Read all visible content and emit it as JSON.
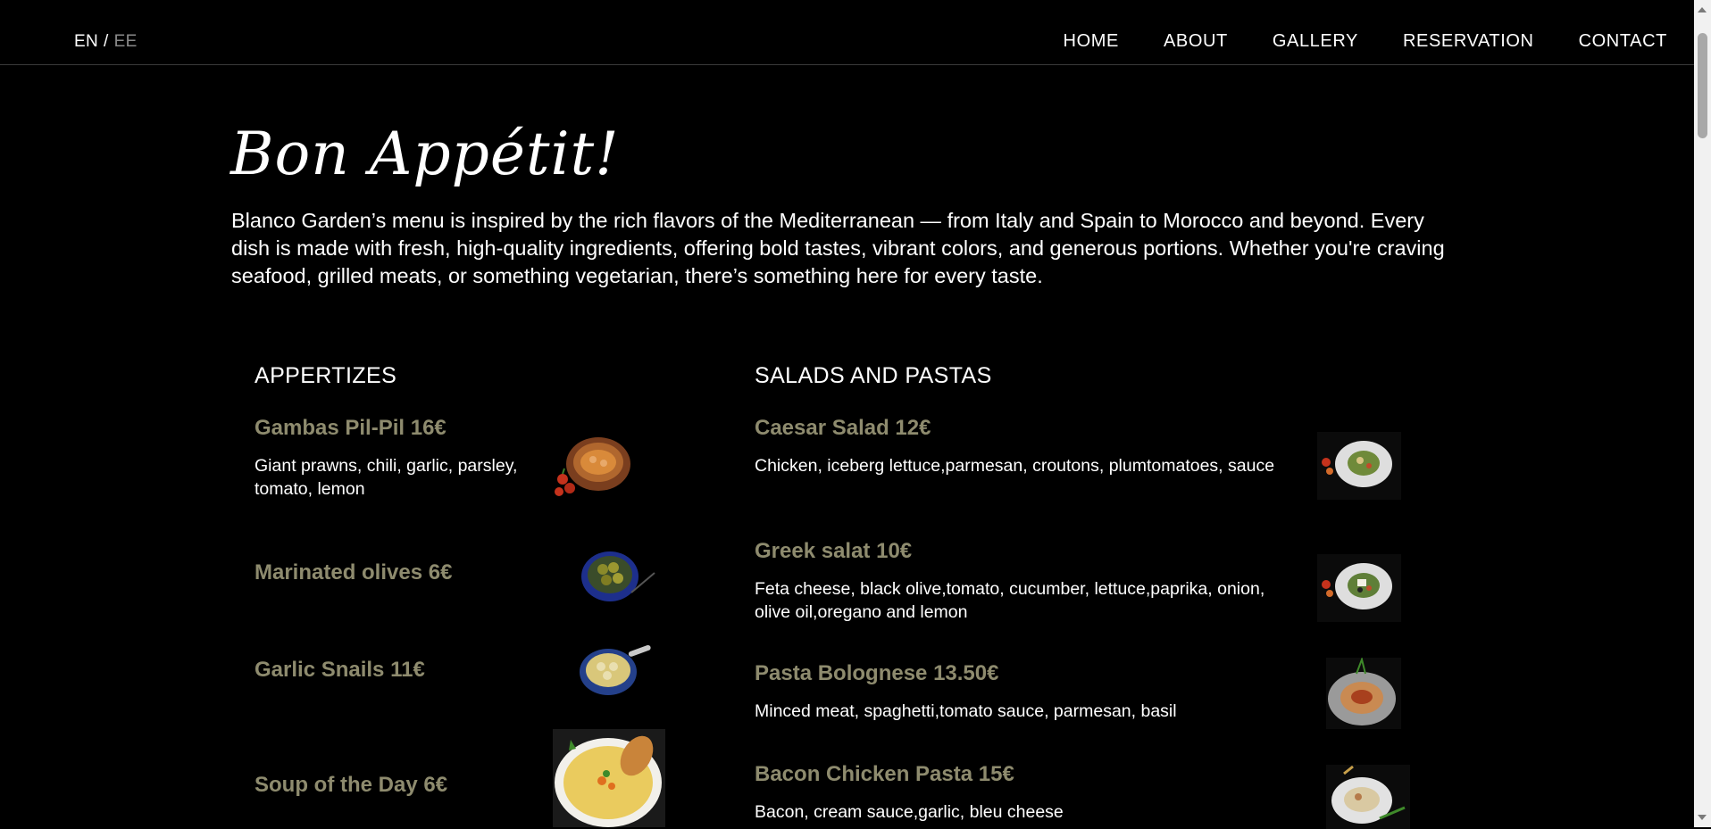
{
  "lang": {
    "active": "EN",
    "separator": "/",
    "inactive": "EE"
  },
  "nav": {
    "home": "HOME",
    "about": "ABOUT",
    "gallery": "GALLERY",
    "reservation": "RESERVATION",
    "contact": "CONTACT"
  },
  "intro": {
    "title": "Bon Appétit!",
    "text": "Blanco Garden’s menu is inspired by the rich flavors of the Mediterranean — from Italy and Spain to Morocco and beyond. Every dish is made with fresh, high-quality ingredients, offering bold tastes, vibrant colors, and generous portions. Whether you're craving seafood, grilled meats, or something vegetarian, there’s something here for every taste."
  },
  "menu": {
    "appetizers": {
      "heading": "APPERTIZES",
      "items": [
        {
          "name": "Gambas Pil-Pil 16€",
          "desc": "Giant prawns, chili, garlic, parsley, tomato, lemon",
          "icon": "gambas-dish-image"
        },
        {
          "name": "Marinated olives 6€",
          "desc": "",
          "icon": "olives-dish-image"
        },
        {
          "name": "Garlic Snails 11€",
          "desc": "",
          "icon": "snails-dish-image"
        },
        {
          "name": "Soup of the Day 6€",
          "desc": "",
          "icon": "soup-dish-image"
        }
      ]
    },
    "salads": {
      "heading": "SALADS AND PASTAS",
      "items": [
        {
          "name": "Caesar Salad 12€",
          "desc": "Chicken, iceberg lettuce,parmesan, croutons, plumtomatoes, sauce",
          "icon": "caesar-salad-image"
        },
        {
          "name": "Greek salat 10€",
          "desc": "Feta cheese, black olive,tomato, cucumber, lettuce,paprika, onion, olive oil,oregano and lemon",
          "icon": "greek-salad-image"
        },
        {
          "name": "Pasta Bolognese 13.50€",
          "desc": "Minced meat, spaghetti,tomato sauce, parmesan, basil",
          "icon": "bolognese-image"
        },
        {
          "name": "Bacon Chicken Pasta 15€",
          "desc": "Bacon, cream sauce,garlic, bleu cheese",
          "icon": "bacon-pasta-image"
        }
      ]
    }
  },
  "colors": {
    "background": "#000000",
    "dish_name": "#8e8b6e",
    "text": "#ffffff"
  }
}
